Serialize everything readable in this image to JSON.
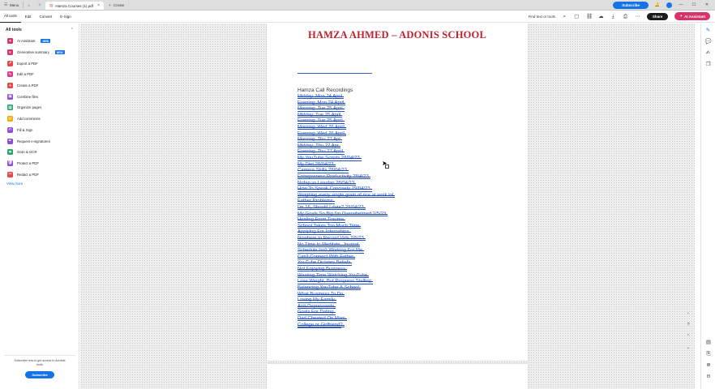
{
  "titlebar": {
    "menu_label": "Menu",
    "tab_title": "Hamza Courses (1).pdf",
    "create_label": "Create",
    "subscribe_label": "Subscribe",
    "win_min": "—",
    "win_max": "☐",
    "win_close": "✕"
  },
  "toolbar": {
    "tabs": [
      "All tools",
      "Edit",
      "Convert",
      "E-Sign"
    ],
    "find_label": "Find text or tools",
    "share_label": "Share",
    "ai_label": "AI Assistant"
  },
  "leftpanel": {
    "title": "All tools",
    "items": [
      {
        "label": "AI Assistant",
        "badge": "NEW",
        "color": "#d8336b",
        "glyph": "✦"
      },
      {
        "label": "Generative summary",
        "badge": "NEW",
        "color": "#d8336b",
        "glyph": "≡"
      },
      {
        "label": "Export a PDF",
        "badge": "",
        "color": "#e5484d",
        "glyph": "↗"
      },
      {
        "label": "Edit a PDF",
        "badge": "",
        "color": "#d93f8e",
        "glyph": "✎"
      },
      {
        "label": "Create a PDF",
        "badge": "",
        "color": "#e5484d",
        "glyph": "+"
      },
      {
        "label": "Combine files",
        "badge": "",
        "color": "#8d4fd1",
        "glyph": "▣"
      },
      {
        "label": "Organize pages",
        "badge": "",
        "color": "#2ba36b",
        "glyph": "▦"
      },
      {
        "label": "Add comments",
        "badge": "",
        "color": "#f2a900",
        "glyph": "✉"
      },
      {
        "label": "Fill & Sign",
        "badge": "",
        "color": "#8d4fd1",
        "glyph": "✍"
      },
      {
        "label": "Request e-signatures",
        "badge": "",
        "color": "#8d4fd1",
        "glyph": "✒"
      },
      {
        "label": "Scan & OCR",
        "badge": "",
        "color": "#2ba36b",
        "glyph": "⌗"
      },
      {
        "label": "Protect a PDF",
        "badge": "",
        "color": "#8d4fd1",
        "glyph": "🛡"
      },
      {
        "label": "Redact a PDF",
        "badge": "",
        "color": "#e5484d",
        "glyph": "✂"
      }
    ],
    "view_more": "View more",
    "footer_text": "Subscribe now to get access to Acrobat tools",
    "footer_button": "Subscribe"
  },
  "document": {
    "title": "HAMZA AHMED – ADONIS SCHOOL",
    "heading": "Hamza Call Recordings",
    "links": [
      "Midday: Mon 24 April",
      "Evening: Mon 24 April",
      "Morning: Tue 25 April",
      "Midday: Tue 25 April",
      "Evening: Tue 25 April",
      "Morning: Wed 26 April",
      "Evening: Wed 26 April",
      "Morning: Thu 27 Apr",
      "Midday: Thu 27 Apr",
      "Evening: Thu 27 April",
      "My YouTube Scripts 28/04/23",
      "My Diet 28/04/23",
      "Camera Skills 28/04/23",
      "Entrepreneur Productivity 28/4/23",
      "Nofap vs Lessfap 28/04/23",
      "How To Speak Concisely 29/04/23",
      "Weighing every single grain of rice at work lol",
      "Father Problems",
      "I'm 16, Should I date? 29/04/23",
      "My Goals So Big I'm Overwhelmed 2/5/23",
      "Healing From Trauma",
      "School Takes Too Much Time",
      "Applying For Internships",
      "Nowhere to Record Vids 2/5/23",
      "No Time to Meditate, Journal",
      "Schedule Isn't Working For Me",
      "Can't Connect With Father",
      "YouTube Dictates Beliefs",
      "Not Enjoying Business",
      "Wasting Time Watching YouTube",
      "Lose Weight, But Progress Stalling",
      "Balancing YouTube & School",
      "What Business To Do",
      "Loving My Family",
      "Anti-Depressants",
      "Goals For Dating",
      "Dad Cheated On Mom",
      "College or Girlfriend?"
    ]
  },
  "zoom": {
    "fit": "‹",
    "page_label": "1",
    "help": "?",
    "down": "⌄"
  },
  "colors": {
    "accent": "#1473e6",
    "title_red": "#c0202b",
    "link_blue": "#1f55c6",
    "ai_pink": "#d8336b"
  }
}
